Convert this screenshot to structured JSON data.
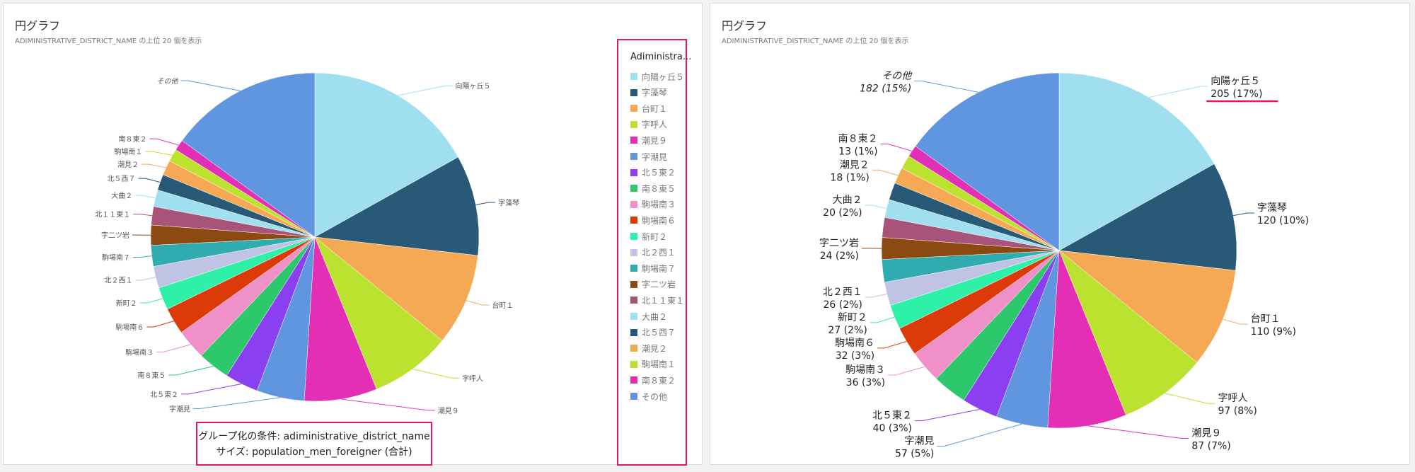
{
  "left_panel": {
    "title": "円グラフ",
    "subtitle": "ADIMINISTRATIVE_DISTRICT_NAME の上位 20 個を表示",
    "caption_line1": "グループ化の条件: adiministrative_district_name",
    "caption_line2": "サイズ: population_men_foreigner (合計)",
    "legend_title": "Adiministra..."
  },
  "right_panel": {
    "title": "円グラフ",
    "subtitle": "ADIMINISTRATIVE_DISTRICT_NAME の上位 20 個を表示"
  },
  "highlight_color": "#e8175d",
  "chart_data": {
    "type": "pie",
    "group_by": "adiministrative_district_name",
    "size": "population_men_foreigner (合計)",
    "start": "top",
    "direction": "clockwise",
    "slices": [
      {
        "label": "向陽ヶ丘５",
        "value": 205,
        "percent": "17%",
        "color": "#a0dff0"
      },
      {
        "label": "字藻琴",
        "value": 120,
        "percent": "10%",
        "color": "#285a78"
      },
      {
        "label": "台町１",
        "value": 110,
        "percent": "9%",
        "color": "#f5a954"
      },
      {
        "label": "字呼人",
        "value": 97,
        "percent": "8%",
        "color": "#bbe22e"
      },
      {
        "label": "潮見９",
        "value": 87,
        "percent": "7%",
        "color": "#e22fb5"
      },
      {
        "label": "字潮見",
        "value": 57,
        "percent": "5%",
        "color": "#6096e0"
      },
      {
        "label": "北５東２",
        "value": 40,
        "percent": "3%",
        "color": "#8a3ff0"
      },
      {
        "label": "南８東５",
        "value": 38,
        "percent": "3%",
        "color": "#2ec86c"
      },
      {
        "label": "駒場南３",
        "value": 36,
        "percent": "3%",
        "color": "#f090c8"
      },
      {
        "label": "駒場南６",
        "value": 32,
        "percent": "3%",
        "color": "#dd3a0a"
      },
      {
        "label": "新町２",
        "value": 27,
        "percent": "2%",
        "color": "#2ef0a8"
      },
      {
        "label": "北２西１",
        "value": 26,
        "percent": "2%",
        "color": "#c0c4e4"
      },
      {
        "label": "駒場南７",
        "value": 25,
        "percent": "2%",
        "color": "#30acb0"
      },
      {
        "label": "字二ツ岩",
        "value": 24,
        "percent": "2%",
        "color": "#8a4a12"
      },
      {
        "label": "北１１東１",
        "value": 22,
        "percent": "2%",
        "color": "#a85478"
      },
      {
        "label": "大曲２",
        "value": 20,
        "percent": "2%",
        "color": "#a0dff0"
      },
      {
        "label": "北５西７",
        "value": 19,
        "percent": "2%",
        "color": "#285a78"
      },
      {
        "label": "潮見２",
        "value": 18,
        "percent": "1%",
        "color": "#f5a954"
      },
      {
        "label": "駒場南１",
        "value": 15,
        "percent": "1%",
        "color": "#bbe22e"
      },
      {
        "label": "南８東２",
        "value": 13,
        "percent": "1%",
        "color": "#e22fb5"
      },
      {
        "label": "その他",
        "value": 182,
        "percent": "15%",
        "color": "#6096e0"
      }
    ],
    "right_chart_labeled": [
      "向陽ヶ丘５",
      "字藻琴",
      "台町１",
      "字呼人",
      "潮見９",
      "字潮見",
      "北５東２",
      "駒場南３",
      "駒場南６",
      "新町２",
      "北２西１",
      "字二ツ岩",
      "大曲２",
      "潮見２",
      "南８東２",
      "その他"
    ]
  }
}
